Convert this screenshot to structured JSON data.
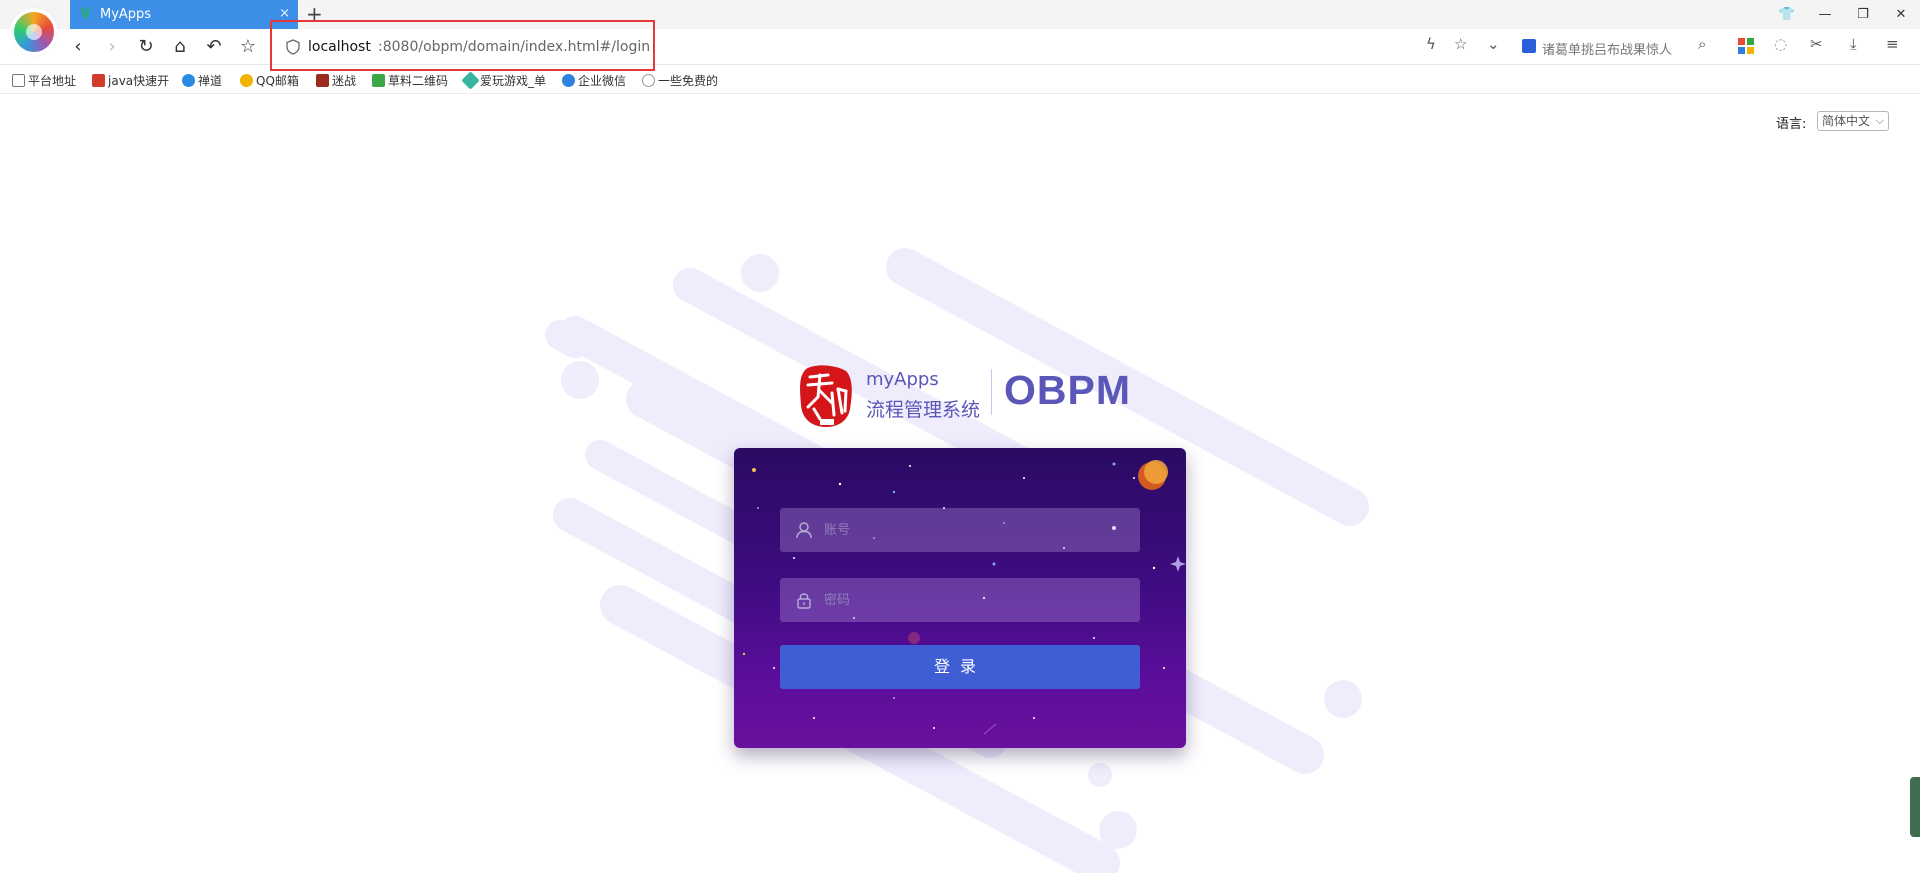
{
  "browser": {
    "tab": {
      "title": "MyApps",
      "close": "×"
    },
    "new_tab": "+",
    "window": {
      "skin": "👕",
      "minimize": "—",
      "restore": "❐",
      "close": "✕"
    },
    "address": {
      "host": "localhost",
      "path": ":8080/obpm/domain/index.html#/login"
    },
    "search_suggestion": "诸葛单挑吕布战果惊人",
    "bookmarks": [
      {
        "label": "平台地址",
        "color": "#888888"
      },
      {
        "label": "java快速开",
        "color": "#d23a2b"
      },
      {
        "label": "禅道",
        "color": "#2a8ae2"
      },
      {
        "label": "QQ邮箱",
        "color": "#f0b400"
      },
      {
        "label": "迷战",
        "color": "#9b2c1f"
      },
      {
        "label": "草料二维码",
        "color": "#39a845"
      },
      {
        "label": "爱玩游戏_单",
        "color": "#36b5a0"
      },
      {
        "label": "企业微信",
        "color": "#2f83e0"
      },
      {
        "label": "一些免费的",
        "color": "#999999"
      }
    ]
  },
  "page": {
    "language_label": "语言:",
    "language_value": "简体中文",
    "brand": {
      "app_name": "myApps",
      "subtitle": "流程管理系统",
      "product": "OBPM"
    },
    "login": {
      "username_placeholder": "账号",
      "password_placeholder": "密码",
      "submit_label": "登录"
    }
  },
  "colors": {
    "accent_tab": "#3d8ee6",
    "brand": "#5a57b8",
    "login_button": "#3f5ed4",
    "highlight": "#e5383b"
  },
  "icons": {
    "username": "user-icon",
    "password": "lock-icon"
  }
}
